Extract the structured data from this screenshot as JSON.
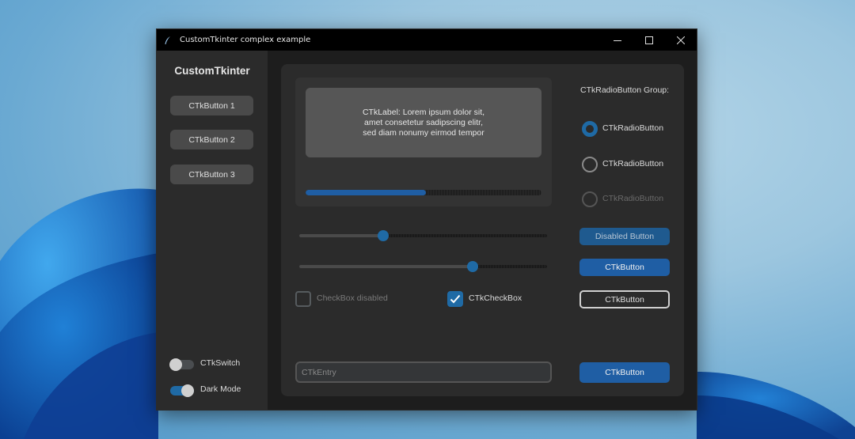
{
  "window": {
    "title": "CustomTkinter complex example"
  },
  "sidebar": {
    "title": "CustomTkinter",
    "buttons": [
      "CTkButton 1",
      "CTkButton 2",
      "CTkButton 3"
    ],
    "switch_label": "CTkSwitch",
    "switch_on": false,
    "dark_mode_label": "Dark Mode",
    "dark_mode_on": true
  },
  "main": {
    "label_text": "CTkLabel: Lorem ipsum dolor sit,\namet consetetur sadipscing elitr,\nsed diam nonumy eirmod tempor",
    "progress": 0.51,
    "slider_1": 0.34,
    "slider_2": 0.7,
    "checkbox_disabled_label": "CheckBox disabled",
    "checkbox_disabled_checked": false,
    "checkbox_label": "CTkCheckBox",
    "checkbox_checked": true,
    "entry_placeholder": "CTkEntry",
    "entry_value": ""
  },
  "radio_group": {
    "title": "CTkRadioButton Group:",
    "options": [
      {
        "label": "CTkRadioButton",
        "selected": true,
        "disabled": false
      },
      {
        "label": "CTkRadioButton",
        "selected": false,
        "disabled": false
      },
      {
        "label": "CTkRadioButton",
        "selected": false,
        "disabled": true
      }
    ]
  },
  "right_buttons": {
    "disabled_label": "Disabled Button",
    "button_label": "CTkButton",
    "outlined_label": "CTkButton",
    "bottom_label": "CTkButton"
  },
  "colors": {
    "accent": "#1f6aa5",
    "window_bg": "#1d1d1d",
    "frame_bg": "#2b2b2b"
  }
}
